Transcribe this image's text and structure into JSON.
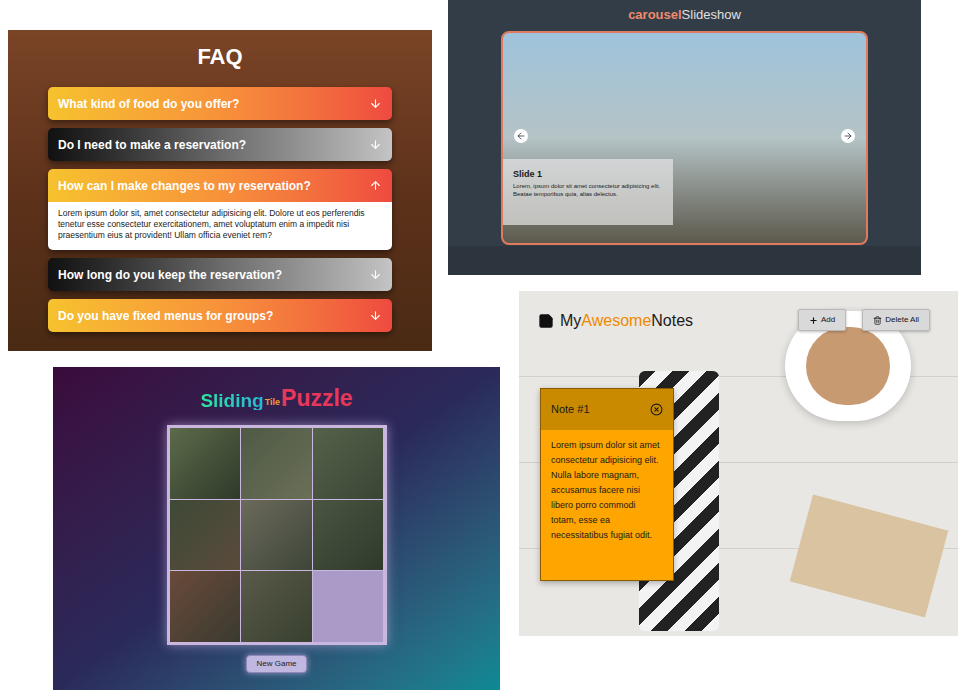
{
  "faq": {
    "title": "FAQ",
    "items": [
      {
        "question": "What kind of food do you offer?",
        "kind": "warm",
        "expanded": false
      },
      {
        "question": "Do I need to make a reservation?",
        "kind": "dark",
        "expanded": false
      },
      {
        "question": "How can I make changes to my reservation?",
        "kind": "warm",
        "expanded": true,
        "answer": "Lorem ipsum dolor sit, amet consectetur adipisicing elit. Dolore ut eos perferendis tenetur esse consectetur exercitationem, amet voluptatum enim a impedit nisi praesentium eius at provident! Ullam officia eveniet rem?"
      },
      {
        "question": "How long do you keep the reservation?",
        "kind": "dark",
        "expanded": false
      },
      {
        "question": "Do you have fixed menus for groups?",
        "kind": "warm",
        "expanded": false
      }
    ]
  },
  "carousel": {
    "title": {
      "first": "carousel",
      "second": "Slideshow"
    },
    "slide": {
      "title": "Slide 1",
      "text": "Lorem, ipsum dolor sit amet consectetur adipisicing elit. Beatae temporibus quia, alias delectus."
    }
  },
  "puzzle": {
    "title": {
      "first": "Sliding",
      "middle": "Tile",
      "last": "Puzzle"
    },
    "tiles": [
      {
        "empty": false
      },
      {
        "empty": false
      },
      {
        "empty": false
      },
      {
        "empty": false
      },
      {
        "empty": false
      },
      {
        "empty": false
      },
      {
        "empty": false
      },
      {
        "empty": false
      },
      {
        "empty": true
      }
    ],
    "button": "New Game"
  },
  "notes": {
    "logo": {
      "first": "My",
      "middle": "Awesome",
      "last": "Notes"
    },
    "buttons": [
      {
        "label": "Add",
        "kind": "plus"
      },
      {
        "label": "Delete All",
        "kind": "trash"
      }
    ],
    "notes": [
      {
        "title": "Note #1",
        "text": "Lorem ipsum dolor sit amet consectetur adipisicing elit. Nulla labore magnam, accusamus facere nisi libero porro commodi totam, esse ea necessitatibus fugiat odit."
      }
    ]
  }
}
